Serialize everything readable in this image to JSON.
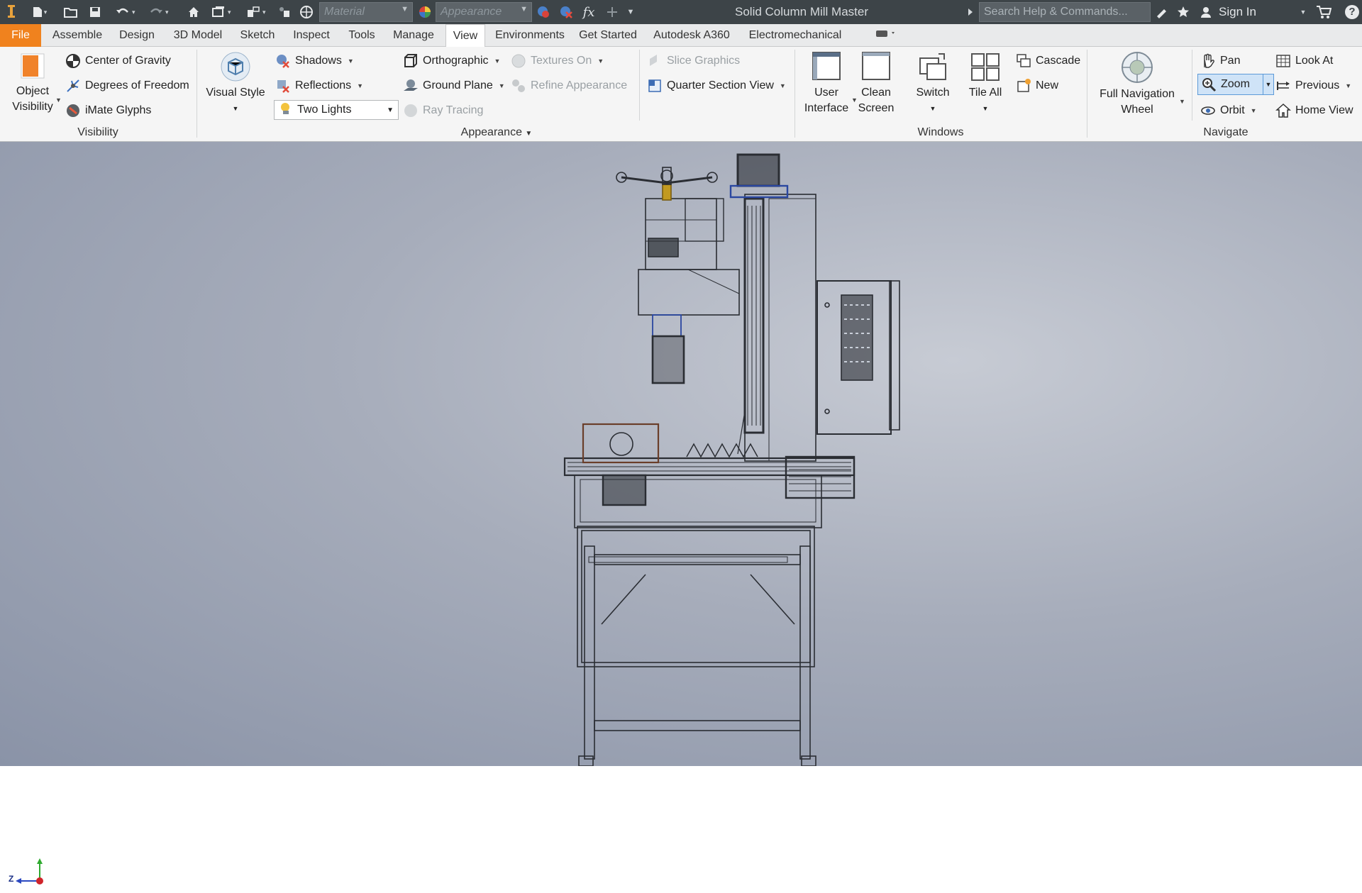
{
  "titlebar": {
    "material_placeholder": "Material",
    "appearance_placeholder": "Appearance",
    "fx_label": "fx",
    "title": "Solid Column Mill Master",
    "search_placeholder": "Search Help & Commands...",
    "sign_in": "Sign In",
    "help_label": "?"
  },
  "tabs": [
    "File",
    "Assemble",
    "Design",
    "3D Model",
    "Sketch",
    "Inspect",
    "Tools",
    "Manage",
    "View",
    "Environments",
    "Get Started",
    "Autodesk A360",
    "Electromechanical"
  ],
  "active_tab": "View",
  "ribbon": {
    "visibility": {
      "object_visibility_1": "Object",
      "object_visibility_2": "Visibility",
      "center_of_gravity": "Center of Gravity",
      "degrees_of_freedom": "Degrees of Freedom",
      "imate_glyphs": "iMate Glyphs",
      "panel_label": "Visibility"
    },
    "appearance": {
      "visual_style": "Visual Style",
      "shadows": "Shadows",
      "reflections": "Reflections",
      "lighting_value": "Two Lights",
      "orthographic": "Orthographic",
      "ground_plane": "Ground Plane",
      "ray_tracing": "Ray Tracing",
      "textures_on": "Textures On",
      "refine_appearance": "Refine Appearance",
      "slice_graphics": "Slice Graphics",
      "quarter_section_view": "Quarter Section View",
      "panel_label": "Appearance"
    },
    "windows": {
      "user_interface_1": "User",
      "user_interface_2": "Interface",
      "clean_screen_1": "Clean",
      "clean_screen_2": "Screen",
      "switch": "Switch",
      "tile_all": "Tile All",
      "cascade": "Cascade",
      "new": "New",
      "panel_label": "Windows"
    },
    "navigate": {
      "full_nav_wheel_1": "Full Navigation",
      "full_nav_wheel_2": "Wheel",
      "pan": "Pan",
      "zoom": "Zoom",
      "orbit": "Orbit",
      "look_at": "Look At",
      "previous": "Previous",
      "home_view": "Home View",
      "panel_label": "Navigate"
    }
  },
  "viewport": {
    "axis_z_label": "Z"
  },
  "colors": {
    "title_bg": "#3d4448",
    "file_tab": "#f0821e",
    "ribbon_bg": "#f5f5f5",
    "zoom_active": "#cfe3f7",
    "viewport_light": "#c7cbd4",
    "viewport_dark": "#8a93a7"
  }
}
